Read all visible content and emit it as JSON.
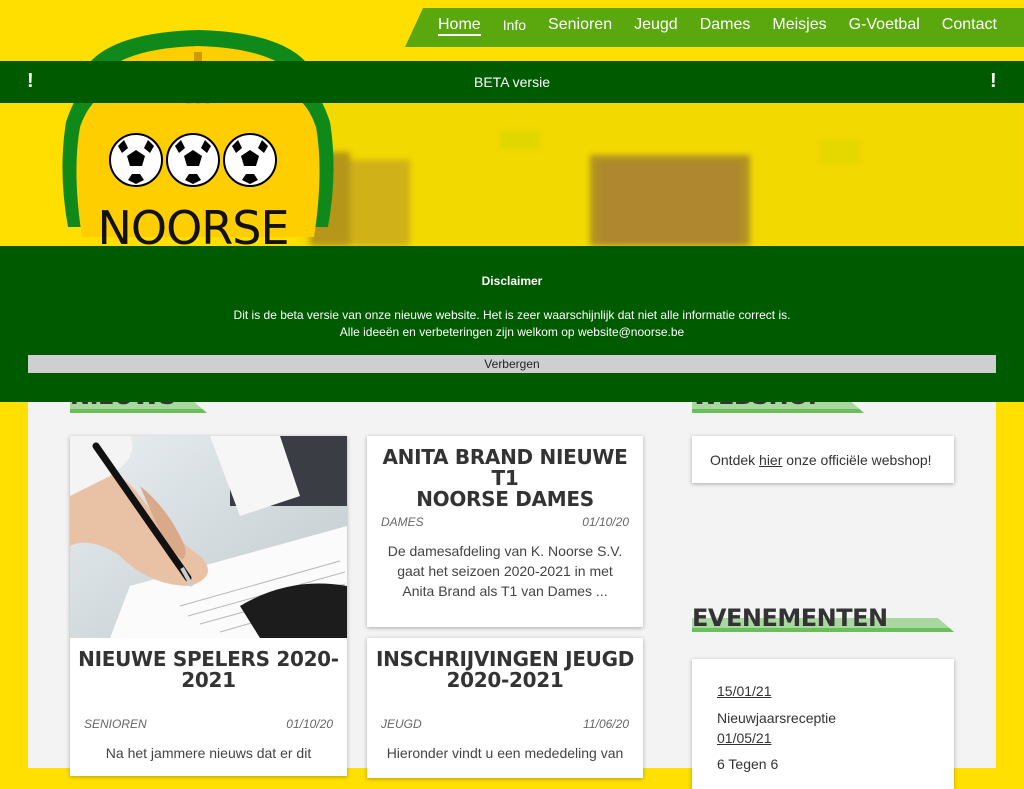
{
  "nav": {
    "items": [
      {
        "label": "Home"
      },
      {
        "label": "Info"
      },
      {
        "label": "Senioren"
      },
      {
        "label": "Jeugd"
      },
      {
        "label": "Dames"
      },
      {
        "label": "Meisjes"
      },
      {
        "label": "G-Voetbal"
      },
      {
        "label": "Contact"
      }
    ],
    "active_index": 0
  },
  "beta_bar": {
    "text": "BETA versie",
    "left_mark": "!",
    "right_mark": "!"
  },
  "logo": {
    "text": "NOORSE"
  },
  "disclaimer": {
    "title": "Disclaimer",
    "line1": "Dit is de beta versie van onze nieuwe website. Het is zeer waarschijnlijk dat niet alle informatie correct is.",
    "line2": "Alle ideeën en verbeteringen zijn welkom op website@noorse.be",
    "button": "Verbergen"
  },
  "sections": {
    "news": "NIEUWS",
    "webshop": "WEBSHOP",
    "events": "EVENEMENTEN"
  },
  "news": [
    {
      "title_line1": "ANITA BRAND NIEUWE T1",
      "title_line2": "NOORSE DAMES",
      "category": "DAMES",
      "date": "01/10/20",
      "excerpt_line1": "De damesafdeling van K. Noorse S.V.",
      "excerpt_line2": "gaat het seizoen 2020-2021 in met",
      "excerpt_line3": "Anita Brand als T1 van Dames ..."
    },
    {
      "title_line1": "NIEUWE SPELERS 2020-",
      "title_line2": "2021",
      "category": "SENIOREN",
      "date": "01/10/20",
      "excerpt_line1": "Na het jammere nieuws dat er dit"
    },
    {
      "title_line1": "INSCHRIJVINGEN JEUGD",
      "title_line2": "2020-2021",
      "category": "JEUGD",
      "date": "11/06/20",
      "excerpt_line1": "Hieronder vindt u een mededeling van"
    }
  ],
  "webshop": {
    "before": "Ontdek ",
    "link": "hier",
    "after": " onze officiële webshop!"
  },
  "events": [
    {
      "date": "15/01/21",
      "name": "Nieuwjaarsreceptie"
    },
    {
      "date": "01/05/21",
      "name": "6 Tegen 6"
    }
  ]
}
